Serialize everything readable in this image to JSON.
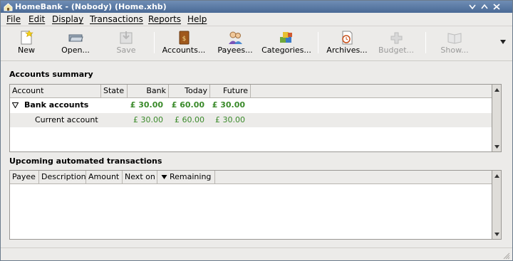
{
  "window": {
    "title": "HomeBank - (Nobody) (Home.xhb)",
    "buttons": [
      "minimize",
      "maximize",
      "close"
    ]
  },
  "menubar": {
    "items": [
      "File",
      "Edit",
      "Display",
      "Transactions",
      "Reports",
      "Help"
    ]
  },
  "toolbar": {
    "items": [
      {
        "label": "New",
        "icon": "new-icon",
        "enabled": true
      },
      {
        "label": "Open...",
        "icon": "open-icon",
        "enabled": true
      },
      {
        "label": "Save",
        "icon": "save-icon",
        "enabled": false
      },
      {
        "label": "Accounts...",
        "icon": "accounts-icon",
        "enabled": true
      },
      {
        "label": "Payees...",
        "icon": "payees-icon",
        "enabled": true
      },
      {
        "label": "Categories...",
        "icon": "categories-icon",
        "enabled": true
      },
      {
        "label": "Archives...",
        "icon": "archives-icon",
        "enabled": true
      },
      {
        "label": "Budget...",
        "icon": "budget-icon",
        "enabled": false
      },
      {
        "label": "Show...",
        "icon": "show-icon",
        "enabled": false
      }
    ]
  },
  "accounts_summary": {
    "title": "Accounts summary",
    "columns": [
      "Account",
      "State",
      "Bank",
      "Today",
      "Future"
    ],
    "groups": [
      {
        "name": "Bank accounts",
        "bank": "£ 30.00",
        "today": "£ 60.00",
        "future": "£ 30.00",
        "rows": [
          {
            "account": "Current account",
            "state": "",
            "bank": "£ 30.00",
            "today": "£ 60.00",
            "future": "£ 30.00"
          }
        ]
      }
    ]
  },
  "upcoming": {
    "title": "Upcoming automated transactions",
    "columns": [
      "Payee",
      "Description",
      "Amount",
      "Next on",
      "Remaining"
    ],
    "sort_icon": "sort-down-icon"
  },
  "colors": {
    "amount_positive": "#3a8a2a",
    "titlebar": "#4a6a96"
  }
}
